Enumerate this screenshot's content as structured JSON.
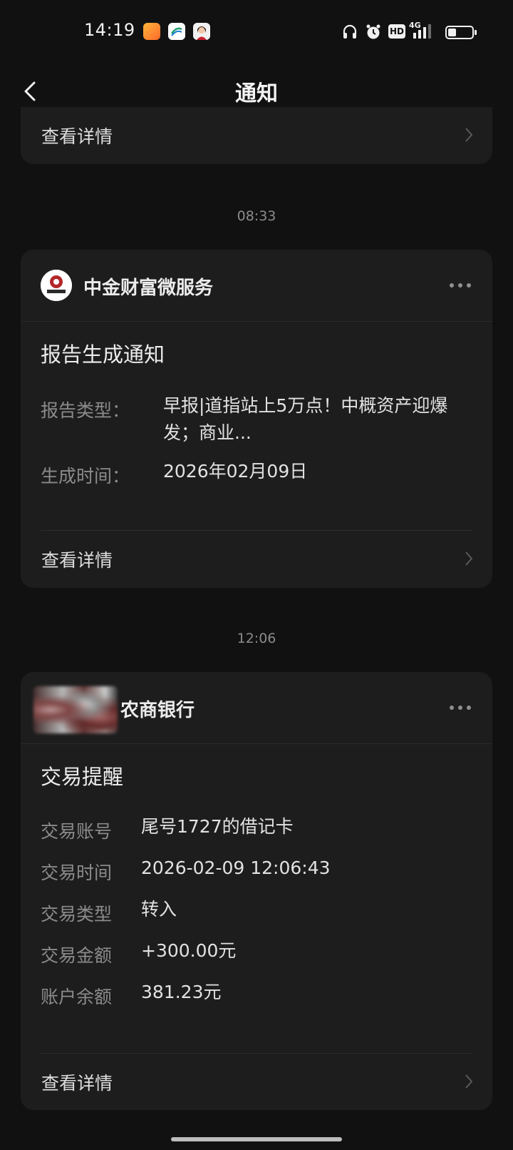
{
  "status_bar": {
    "time": "14:19",
    "network": "4G",
    "hd_label": "HD",
    "icons": [
      "headset-icon",
      "alarm-icon",
      "hd-icon",
      "signal-icon",
      "battery-icon"
    ]
  },
  "nav": {
    "title": "通知"
  },
  "top_card": {
    "detail_label": "查看详情"
  },
  "notifications": [
    {
      "timestamp": "08:33",
      "sender": "中金财富微服务",
      "title": "报告生成通知",
      "fields": [
        {
          "label": "报告类型：",
          "value": "早报|道指站上5万点！中概资产迎爆发；商业..."
        },
        {
          "label": "生成时间：",
          "value": "2026年02月09日"
        }
      ],
      "detail_label": "查看详情"
    },
    {
      "timestamp": "12:06",
      "sender": "农商银行",
      "title": "交易提醒",
      "fields": [
        {
          "label": "交易账号",
          "value": "尾号1727的借记卡"
        },
        {
          "label": "交易时间",
          "value": "2026-02-09 12:06:43"
        },
        {
          "label": "交易类型",
          "value": "转入"
        },
        {
          "label": "交易金额",
          "value": "+300.00元"
        },
        {
          "label": "账户余额",
          "value": "381.23元"
        }
      ],
      "detail_label": "查看详情"
    }
  ],
  "colors": {
    "background": "#111111",
    "card": "#1d1d1d",
    "accent_text": "#e6e6e6",
    "muted_text": "#8b8b8b"
  }
}
